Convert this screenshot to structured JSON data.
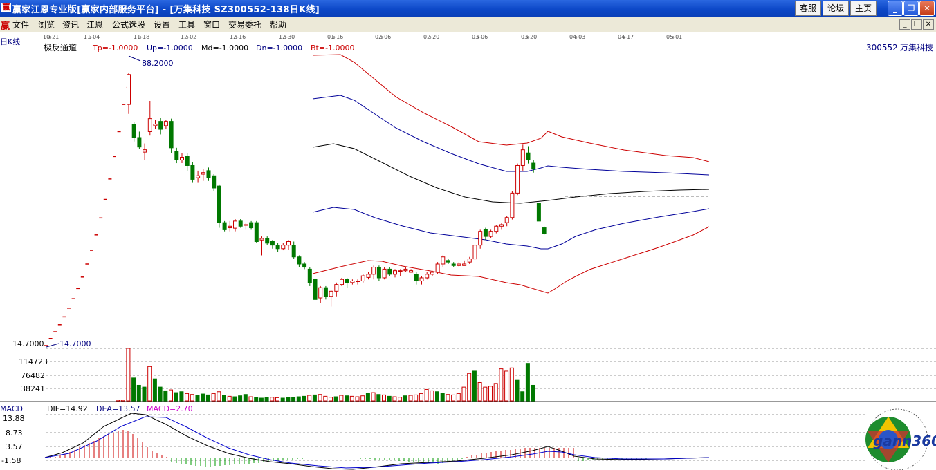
{
  "window": {
    "icon": "赢",
    "title": "赢家江恩专业版[赢家内部服务平台] - [万集科技   SZ300552-138日K线]",
    "buttons": [
      "客服",
      "论坛",
      "主页"
    ]
  },
  "menu": {
    "logo": "赢",
    "items": [
      "文件",
      "浏览",
      "资讯",
      "江恩",
      "公式选股",
      "设置",
      "工具",
      "窗口",
      "交易委托",
      "帮助"
    ]
  },
  "header": {
    "kline_label": "日K线",
    "indicator_name": "极反通道",
    "params": [
      "Tp=-1.0000",
      "Up=-1.0000",
      "Md=-1.0000",
      "Dn=-1.0000",
      "Bt=-1.0000"
    ],
    "stock_code": "300552",
    "stock_name": "万集科技",
    "date_ticks": [
      "10-21",
      "11-04",
      "11-18",
      "12-02",
      "12-16",
      "12-30",
      "01-16",
      "02-06",
      "02-20",
      "03-06",
      "03-20",
      "04-03",
      "04-17",
      "05-01"
    ]
  },
  "price_panel": {
    "high_label": "88.2000",
    "low_label": "14.7000",
    "low_axis": "14.7000"
  },
  "volume_panel": {
    "ticks": [
      "114723",
      "76482",
      "38241"
    ]
  },
  "macd_panel": {
    "name": "MACD",
    "dif": "DIF=14.92",
    "dea": "DEA=13.57",
    "macd": "MACD=2.70",
    "ticks": [
      "13.88",
      "8.73",
      "3.57",
      "-1.58"
    ]
  },
  "watermark": {
    "brand": "gann360"
  },
  "chart_data": {
    "type": "candlestick",
    "price_range": [
      14.7,
      88.2
    ],
    "ramp_closes": [
      14.7,
      16.5,
      18.2,
      20.0,
      22.0,
      24.2,
      26.6,
      29.2,
      32.1,
      35.4,
      38.9,
      42.8,
      47.1,
      51.8,
      57.0,
      62.7,
      69.0,
      75.9,
      80.2
    ],
    "candles": [
      [
        75.9,
        83.5,
        73.5,
        84.0
      ],
      [
        70.9,
        67.5,
        66.5,
        71.5
      ],
      [
        67.5,
        65.1,
        64.6,
        69.0
      ],
      [
        63.8,
        64.4,
        61.8,
        66.0
      ],
      [
        69.0,
        72.3,
        68.0,
        76.8
      ],
      [
        70.5,
        70.9,
        69.6,
        72.0
      ],
      [
        71.6,
        69.6,
        68.3,
        72.5
      ],
      [
        70.5,
        71.6,
        69.6,
        72.0
      ],
      [
        71.6,
        64.9,
        63.6,
        72.3
      ],
      [
        64.0,
        61.8,
        61.0,
        64.9
      ],
      [
        61.8,
        62.5,
        61.0,
        63.6
      ],
      [
        62.7,
        60.4,
        59.1,
        63.6
      ],
      [
        60.4,
        56.9,
        56.0,
        61.2
      ],
      [
        57.3,
        57.8,
        56.0,
        59.1
      ],
      [
        58.2,
        58.6,
        56.5,
        59.5
      ],
      [
        59.1,
        57.3,
        56.5,
        59.9
      ],
      [
        57.8,
        54.7,
        53.9,
        58.2
      ],
      [
        55.2,
        45.9,
        44.6,
        55.6
      ],
      [
        45.9,
        44.1,
        43.7,
        46.3
      ],
      [
        44.6,
        45.0,
        43.7,
        46.3
      ],
      [
        44.5,
        46.3,
        43.7,
        46.8
      ],
      [
        46.3,
        45.0,
        44.6,
        46.8
      ],
      [
        45.4,
        45.4,
        44.1,
        45.9
      ],
      [
        45.9,
        44.6,
        44.1,
        46.3
      ],
      [
        45.9,
        41.1,
        40.7,
        46.3
      ],
      [
        41.5,
        41.9,
        37.6,
        42.4
      ],
      [
        41.9,
        40.7,
        40.2,
        42.4
      ],
      [
        41.1,
        40.2,
        39.3,
        41.5
      ],
      [
        40.2,
        39.3,
        38.5,
        40.7
      ],
      [
        39.3,
        40.2,
        38.9,
        40.7
      ],
      [
        40.2,
        41.1,
        38.9,
        41.5
      ],
      [
        40.2,
        37.2,
        36.7,
        41.1
      ],
      [
        37.2,
        35.4,
        34.6,
        37.6
      ],
      [
        35.4,
        34.6,
        34.1,
        35.9
      ],
      [
        34.1,
        30.7,
        29.8,
        34.6
      ],
      [
        31.5,
        26.4,
        25.1,
        31.9
      ],
      [
        26.8,
        29.4,
        25.5,
        29.8
      ],
      [
        29.4,
        27.2,
        26.4,
        29.8
      ],
      [
        27.2,
        28.5,
        24.6,
        28.9
      ],
      [
        28.5,
        30.2,
        27.2,
        30.7
      ],
      [
        30.2,
        31.5,
        29.8,
        31.9
      ],
      [
        31.5,
        30.7,
        29.4,
        31.9
      ],
      [
        30.7,
        31.1,
        30.2,
        31.5
      ],
      [
        31.1,
        31.1,
        30.2,
        31.5
      ],
      [
        31.1,
        32.4,
        30.7,
        32.8
      ],
      [
        32.0,
        32.8,
        31.5,
        33.3
      ],
      [
        32.8,
        34.6,
        31.5,
        35.0
      ],
      [
        34.6,
        31.9,
        31.1,
        35.0
      ],
      [
        31.9,
        34.1,
        31.5,
        34.6
      ],
      [
        34.1,
        32.8,
        32.4,
        34.6
      ],
      [
        32.8,
        33.7,
        32.0,
        34.1
      ],
      [
        33.7,
        33.7,
        32.4,
        34.1
      ],
      [
        33.7,
        34.1,
        33.3,
        34.6
      ],
      [
        33.3,
        33.7,
        33.3,
        34.1
      ],
      [
        32.8,
        31.1,
        30.2,
        33.3
      ],
      [
        31.1,
        31.9,
        30.2,
        32.4
      ],
      [
        31.9,
        32.8,
        31.5,
        33.3
      ],
      [
        32.8,
        33.3,
        32.4,
        33.7
      ],
      [
        33.3,
        35.4,
        32.8,
        35.9
      ],
      [
        35.4,
        37.2,
        34.6,
        37.6
      ],
      [
        36.3,
        35.9,
        35.4,
        36.7
      ],
      [
        35.4,
        35.0,
        34.6,
        35.9
      ],
      [
        35.0,
        35.4,
        34.6,
        35.9
      ],
      [
        35.0,
        35.4,
        35.0,
        36.3
      ],
      [
        35.9,
        36.7,
        35.4,
        37.2
      ],
      [
        36.7,
        40.2,
        35.4,
        41.1
      ],
      [
        40.2,
        43.7,
        39.3,
        44.1
      ],
      [
        44.1,
        42.4,
        41.5,
        44.6
      ],
      [
        42.4,
        43.7,
        41.9,
        44.1
      ],
      [
        43.7,
        45.0,
        43.2,
        45.4
      ],
      [
        45.0,
        45.4,
        44.1,
        45.9
      ],
      [
        45.9,
        47.2,
        45.0,
        47.6
      ],
      [
        47.2,
        53.4,
        46.7,
        53.9
      ],
      [
        53.4,
        60.4,
        52.9,
        60.9
      ],
      [
        60.4,
        64.4,
        59.1,
        65.7
      ],
      [
        63.6,
        61.8,
        60.9,
        65.3
      ],
      [
        61.0,
        59.5,
        58.6,
        61.8
      ],
      [
        50.8,
        46.3,
        46.3,
        50.8
      ],
      [
        44.6,
        43.2,
        42.8,
        45.0
      ]
    ],
    "bands": {
      "top": [
        [
          452,
          80
        ],
        [
          492,
          79
        ],
        [
          512,
          90
        ],
        [
          542,
          115
        ],
        [
          572,
          140
        ],
        [
          612,
          163
        ],
        [
          652,
          183
        ],
        [
          692,
          205
        ],
        [
          732,
          210
        ],
        [
          762,
          207
        ],
        [
          782,
          200
        ],
        [
          792,
          190
        ],
        [
          812,
          198
        ],
        [
          852,
          207
        ],
        [
          902,
          217
        ],
        [
          962,
          225
        ],
        [
          1002,
          228
        ],
        [
          1025,
          234
        ]
      ],
      "upper": [
        [
          452,
          143
        ],
        [
          492,
          138
        ],
        [
          512,
          145
        ],
        [
          542,
          165
        ],
        [
          572,
          185
        ],
        [
          612,
          205
        ],
        [
          652,
          222
        ],
        [
          692,
          237
        ],
        [
          732,
          248
        ],
        [
          762,
          248
        ],
        [
          782,
          243
        ],
        [
          792,
          240
        ],
        [
          812,
          242
        ],
        [
          852,
          245
        ],
        [
          902,
          248
        ],
        [
          962,
          250
        ],
        [
          1025,
          253
        ]
      ],
      "middle": [
        [
          452,
          213
        ],
        [
          482,
          208
        ],
        [
          512,
          215
        ],
        [
          552,
          235
        ],
        [
          592,
          255
        ],
        [
          632,
          272
        ],
        [
          672,
          285
        ],
        [
          712,
          292
        ],
        [
          752,
          294
        ],
        [
          792,
          290
        ],
        [
          832,
          285
        ],
        [
          882,
          280
        ],
        [
          932,
          277
        ],
        [
          982,
          275
        ],
        [
          1025,
          274
        ]
      ],
      "lower": [
        [
          452,
          307
        ],
        [
          482,
          300
        ],
        [
          512,
          303
        ],
        [
          542,
          315
        ],
        [
          582,
          327
        ],
        [
          622,
          337
        ],
        [
          662,
          342
        ],
        [
          702,
          347
        ],
        [
          732,
          353
        ],
        [
          762,
          356
        ],
        [
          782,
          360
        ],
        [
          792,
          360
        ],
        [
          812,
          353
        ],
        [
          832,
          342
        ],
        [
          862,
          332
        ],
        [
          902,
          323
        ],
        [
          952,
          314
        ],
        [
          1002,
          306
        ],
        [
          1025,
          302
        ]
      ],
      "bottom": [
        [
          452,
          396
        ],
        [
          492,
          386
        ],
        [
          532,
          377
        ],
        [
          552,
          378
        ],
        [
          582,
          385
        ],
        [
          622,
          392
        ],
        [
          652,
          398
        ],
        [
          692,
          400
        ],
        [
          732,
          409
        ],
        [
          752,
          412
        ],
        [
          772,
          418
        ],
        [
          792,
          424
        ],
        [
          802,
          418
        ],
        [
          822,
          405
        ],
        [
          852,
          390
        ],
        [
          902,
          374
        ],
        [
          952,
          358
        ],
        [
          1002,
          340
        ],
        [
          1025,
          328
        ]
      ]
    },
    "volumes": [
      2000,
      2000,
      114723,
      50000,
      34000,
      30000,
      75000,
      48000,
      30000,
      22000,
      24000,
      18000,
      20000,
      16000,
      14000,
      12000,
      15000,
      13000,
      16000,
      20000,
      12000,
      10000,
      9000,
      11000,
      14000,
      9000,
      8000,
      6000,
      7000,
      8000,
      7000,
      6000,
      7000,
      8000,
      9000,
      10000,
      12000,
      13000,
      14000,
      10000,
      8000,
      9000,
      12000,
      11000,
      10000,
      9000,
      11000,
      16000,
      18000,
      14000,
      13000,
      10000,
      9000,
      8000,
      11000,
      12000,
      13000,
      16000,
      25000,
      22000,
      20000,
      16000,
      14000,
      13000,
      16000,
      30000,
      60000,
      65000,
      40000,
      30000,
      32000,
      38000,
      70000,
      65000,
      72000,
      45000,
      20000,
      82000,
      34000
    ],
    "volume_up": [
      true,
      true,
      true,
      false,
      false,
      false,
      true,
      false,
      false,
      false,
      true,
      false,
      false,
      true,
      true,
      false,
      false,
      false,
      true,
      true,
      false,
      true,
      false,
      false,
      false,
      true,
      false,
      false,
      false,
      true,
      true,
      false,
      false,
      false,
      false,
      false,
      true,
      false,
      true,
      true,
      true,
      false,
      true,
      false,
      true,
      true,
      true,
      false,
      true,
      false,
      true,
      false,
      true,
      true,
      false,
      true,
      true,
      true,
      true,
      true,
      false,
      false,
      true,
      true,
      true,
      true,
      true,
      false,
      true,
      true,
      true,
      true,
      true,
      true,
      true,
      false,
      false,
      false,
      false
    ],
    "macd_range": [
      -3.5,
      15.5
    ],
    "dif_line": [
      [
        65,
        662
      ],
      [
        90,
        655
      ],
      [
        120,
        641
      ],
      [
        150,
        617
      ],
      [
        175,
        605
      ],
      [
        190,
        598
      ],
      [
        210,
        600
      ],
      [
        240,
        614
      ],
      [
        270,
        631
      ],
      [
        300,
        645
      ],
      [
        330,
        656
      ],
      [
        360,
        663
      ],
      [
        390,
        668
      ],
      [
        420,
        671
      ],
      [
        450,
        675
      ],
      [
        480,
        678
      ],
      [
        510,
        679
      ],
      [
        540,
        676
      ],
      [
        580,
        671
      ],
      [
        620,
        669
      ],
      [
        660,
        667
      ],
      [
        700,
        663
      ],
      [
        740,
        658
      ],
      [
        770,
        652
      ],
      [
        792,
        646
      ],
      [
        810,
        652
      ],
      [
        830,
        660
      ],
      [
        860,
        664
      ],
      [
        900,
        665
      ],
      [
        960,
        664
      ],
      [
        1025,
        662
      ]
    ],
    "dea_line": [
      [
        65,
        662
      ],
      [
        100,
        656
      ],
      [
        140,
        638
      ],
      [
        175,
        617
      ],
      [
        210,
        603
      ],
      [
        240,
        604
      ],
      [
        270,
        618
      ],
      [
        300,
        634
      ],
      [
        330,
        648
      ],
      [
        360,
        658
      ],
      [
        390,
        665
      ],
      [
        420,
        670
      ],
      [
        460,
        674
      ],
      [
        500,
        677
      ],
      [
        540,
        676
      ],
      [
        580,
        673
      ],
      [
        620,
        670
      ],
      [
        660,
        668
      ],
      [
        700,
        665
      ],
      [
        740,
        661
      ],
      [
        770,
        657
      ],
      [
        792,
        653
      ],
      [
        812,
        654
      ],
      [
        830,
        658
      ],
      [
        860,
        662
      ],
      [
        900,
        664
      ],
      [
        960,
        664
      ],
      [
        1025,
        662
      ]
    ],
    "macd_bars_top": [
      -1,
      -1,
      -1,
      -3,
      -5,
      -8,
      -11,
      -15,
      -18,
      -21,
      -24,
      -28,
      -31,
      -34,
      -36,
      -38,
      -40,
      -38,
      -34,
      -28,
      -22,
      -15,
      -10,
      -6,
      -3,
      -1,
      6,
      8,
      9,
      10,
      11,
      12,
      12,
      13,
      13,
      12,
      12,
      11,
      11,
      10,
      10,
      9,
      9,
      8,
      8,
      7,
      6,
      5,
      5,
      4,
      3,
      3,
      2,
      2,
      1,
      1,
      1,
      1,
      1,
      1,
      1,
      1,
      1,
      1,
      1,
      2,
      2,
      2,
      3,
      3,
      3,
      4,
      4,
      5,
      5,
      6,
      6,
      7,
      7,
      8,
      8,
      9,
      8,
      7,
      5,
      3,
      2,
      -1,
      -3,
      -4,
      -6,
      -6,
      -8,
      -9,
      -9,
      -11,
      -11,
      -13,
      -13,
      -14,
      -14,
      -14,
      -14,
      -14,
      -14,
      -14,
      -14,
      -14,
      -14,
      -14,
      5,
      5,
      4,
      4,
      4,
      4,
      4,
      3,
      3,
      3,
      3,
      2,
      2,
      2,
      2,
      1,
      1,
      1,
      1,
      1,
      1,
      1,
      1,
      1,
      1,
      1,
      1
    ]
  }
}
